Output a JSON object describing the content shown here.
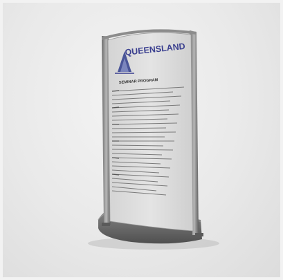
{
  "sign": {
    "brand": "QUEENSLAND",
    "heading": "SEMINAR PROGRAM"
  },
  "colors": {
    "background": "#e8e8e8",
    "frame": "#8a8a8a",
    "panel": "#dedede",
    "brand_text": "#3a3f8f",
    "logo": "#4a5598",
    "base": "#6b6b6b"
  }
}
